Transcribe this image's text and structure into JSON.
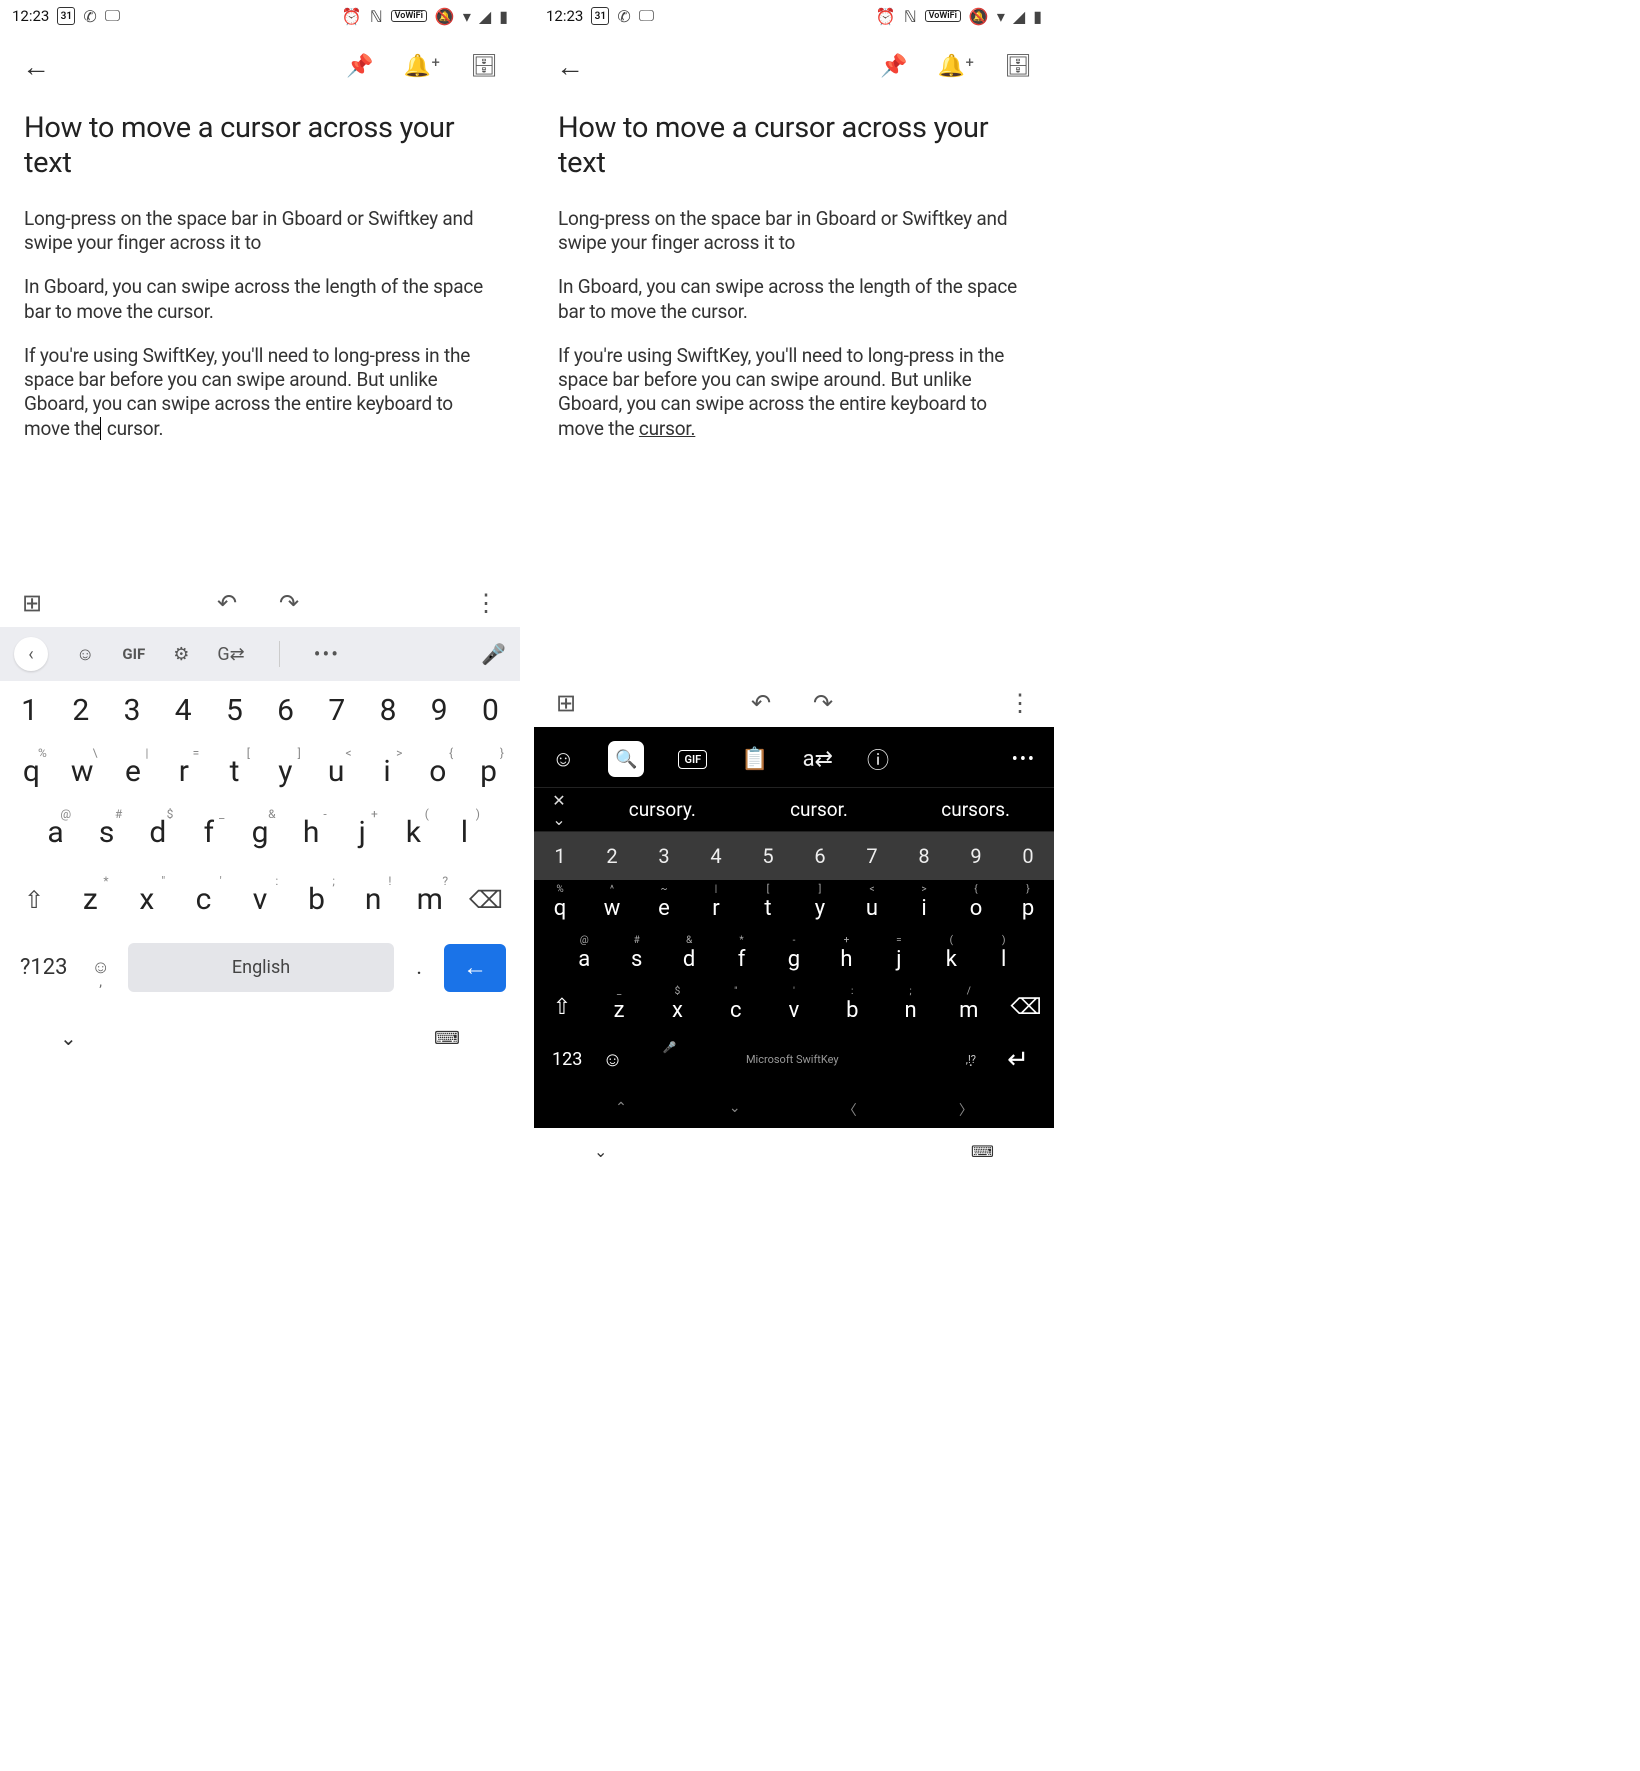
{
  "status": {
    "time": "12:23",
    "calendar_day": "31",
    "vowifi_chip": "VoWiFi"
  },
  "note": {
    "title": "How to move a cursor across your text",
    "p1": "Long-press on the space bar in Gboard or Swiftkey and swipe your finger across it to",
    "p2": "In Gboard, you can swipe across the length of the space bar to move the cursor.",
    "p3_prefix": "If you're using SwiftKey, you'll need to long-press in the space bar before you can swipe around. But unlike Gboard, you can swipe across the entire keyboard to move the",
    "p3_word": "cursor."
  },
  "gboard": {
    "gif": "GIF",
    "numbers": [
      "1",
      "2",
      "3",
      "4",
      "5",
      "6",
      "7",
      "8",
      "9",
      "0"
    ],
    "row2": [
      {
        "k": "q",
        "s": "%"
      },
      {
        "k": "w",
        "s": "\\"
      },
      {
        "k": "e",
        "s": "|"
      },
      {
        "k": "r",
        "s": "="
      },
      {
        "k": "t",
        "s": "["
      },
      {
        "k": "y",
        "s": "]"
      },
      {
        "k": "u",
        "s": "<"
      },
      {
        "k": "i",
        "s": ">"
      },
      {
        "k": "o",
        "s": "{"
      },
      {
        "k": "p",
        "s": "}"
      }
    ],
    "row3": [
      {
        "k": "a",
        "s": "@"
      },
      {
        "k": "s",
        "s": "#"
      },
      {
        "k": "d",
        "s": "$"
      },
      {
        "k": "f",
        "s": "_"
      },
      {
        "k": "g",
        "s": "&"
      },
      {
        "k": "h",
        "s": "-"
      },
      {
        "k": "j",
        "s": "+"
      },
      {
        "k": "k",
        "s": "("
      },
      {
        "k": "l",
        "s": ")"
      }
    ],
    "row4": [
      {
        "k": "z",
        "s": "*"
      },
      {
        "k": "x",
        "s": "\""
      },
      {
        "k": "c",
        "s": "'"
      },
      {
        "k": "v",
        "s": ":"
      },
      {
        "k": "b",
        "s": ";"
      },
      {
        "k": "n",
        "s": "!"
      },
      {
        "k": "m",
        "s": "?"
      }
    ],
    "sym": "?123",
    "space": "English",
    "period": "."
  },
  "swiftkey": {
    "gif": "GIF",
    "suggestions": [
      "cursory.",
      "cursor.",
      "cursors."
    ],
    "numbers": [
      "1",
      "2",
      "3",
      "4",
      "5",
      "6",
      "7",
      "8",
      "9",
      "0"
    ],
    "row2": [
      {
        "k": "q",
        "s": "%"
      },
      {
        "k": "w",
        "s": "^"
      },
      {
        "k": "e",
        "s": "~"
      },
      {
        "k": "r",
        "s": "|"
      },
      {
        "k": "t",
        "s": "["
      },
      {
        "k": "y",
        "s": "]"
      },
      {
        "k": "u",
        "s": "<"
      },
      {
        "k": "i",
        "s": ">"
      },
      {
        "k": "o",
        "s": "{"
      },
      {
        "k": "p",
        "s": "}"
      }
    ],
    "row3": [
      {
        "k": "a",
        "s": "@"
      },
      {
        "k": "s",
        "s": "#"
      },
      {
        "k": "d",
        "s": "&"
      },
      {
        "k": "f",
        "s": "*"
      },
      {
        "k": "g",
        "s": "-"
      },
      {
        "k": "h",
        "s": "+"
      },
      {
        "k": "j",
        "s": "="
      },
      {
        "k": "k",
        "s": "("
      },
      {
        "k": "l",
        "s": ")"
      }
    ],
    "row4": [
      {
        "k": "z",
        "s": "_"
      },
      {
        "k": "x",
        "s": "$"
      },
      {
        "k": "c",
        "s": "\""
      },
      {
        "k": "v",
        "s": "'"
      },
      {
        "k": "b",
        "s": ":"
      },
      {
        "k": "n",
        "s": ";"
      },
      {
        "k": "m",
        "s": "/"
      }
    ],
    "sym": "123",
    "space": "Microsoft SwiftKey",
    "punct": ",!?"
  }
}
